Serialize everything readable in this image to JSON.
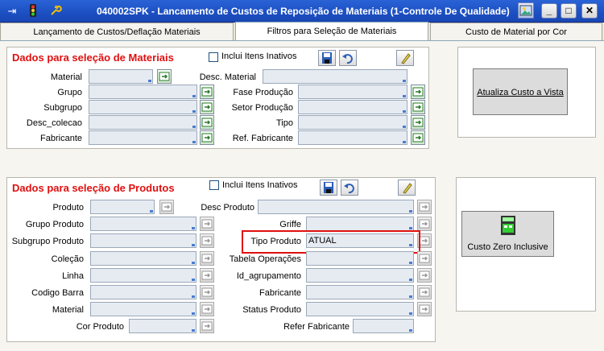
{
  "window": {
    "title": "040002SPK - Lancamento de Custos de Reposição de Materiais (1-Controle De Qualidade)",
    "icons": [
      "exit-icon",
      "traffic-light-icon",
      "wrench-icon"
    ]
  },
  "tabs": [
    {
      "label": "Lançamento de Custos/Deflação Materiais"
    },
    {
      "label": "Filtros para Seleção de Materiais"
    },
    {
      "label": "Custo de Material por Cor"
    }
  ],
  "materiais": {
    "title": "Dados para seleção de Materiais",
    "inclui_label": "Inclui Itens Inativos",
    "left_fields": [
      {
        "label": "Material",
        "value": ""
      },
      {
        "label": "Grupo",
        "value": ""
      },
      {
        "label": "Subgrupo",
        "value": ""
      },
      {
        "label": "Desc_colecao",
        "value": ""
      },
      {
        "label": "Fabricante",
        "value": ""
      }
    ],
    "right_fields": [
      {
        "label": "Desc. Material",
        "value": ""
      },
      {
        "label": "Fase Produção",
        "value": ""
      },
      {
        "label": "Setor Produção",
        "value": ""
      },
      {
        "label": "Tipo",
        "value": ""
      },
      {
        "label": "Ref. Fabricante",
        "value": ""
      }
    ]
  },
  "produtos": {
    "title": "Dados para seleção de Produtos",
    "inclui_label": "Inclui Itens Inativos",
    "left_fields": [
      {
        "label": "Produto",
        "value": ""
      },
      {
        "label": "Grupo Produto",
        "value": ""
      },
      {
        "label": "Subgrupo Produto",
        "value": ""
      },
      {
        "label": "Coleção",
        "value": ""
      },
      {
        "label": "Linha",
        "value": ""
      },
      {
        "label": "Codigo Barra",
        "value": ""
      },
      {
        "label": "Material",
        "value": ""
      },
      {
        "label": "Cor Produto",
        "value": ""
      }
    ],
    "right_fields": [
      {
        "label": "Desc Produto",
        "value": ""
      },
      {
        "label": "Griffe",
        "value": ""
      },
      {
        "label": "Tipo Produto",
        "value": "ATUAL"
      },
      {
        "label": "Tabela Operações",
        "value": ""
      },
      {
        "label": "Id_agrupamento",
        "value": ""
      },
      {
        "label": "Fabricante",
        "value": ""
      },
      {
        "label": "Status Produto",
        "value": ""
      },
      {
        "label": "Refer Fabricante",
        "value": ""
      }
    ]
  },
  "actions": {
    "atualiza_label": "Atualiza Custo a Vista",
    "custo_zero_label": "Custo Zero Inclusive"
  },
  "colors": {
    "section_title": "#e01010",
    "highlight": "#e01010",
    "titlebar": "#1c4fc2"
  }
}
